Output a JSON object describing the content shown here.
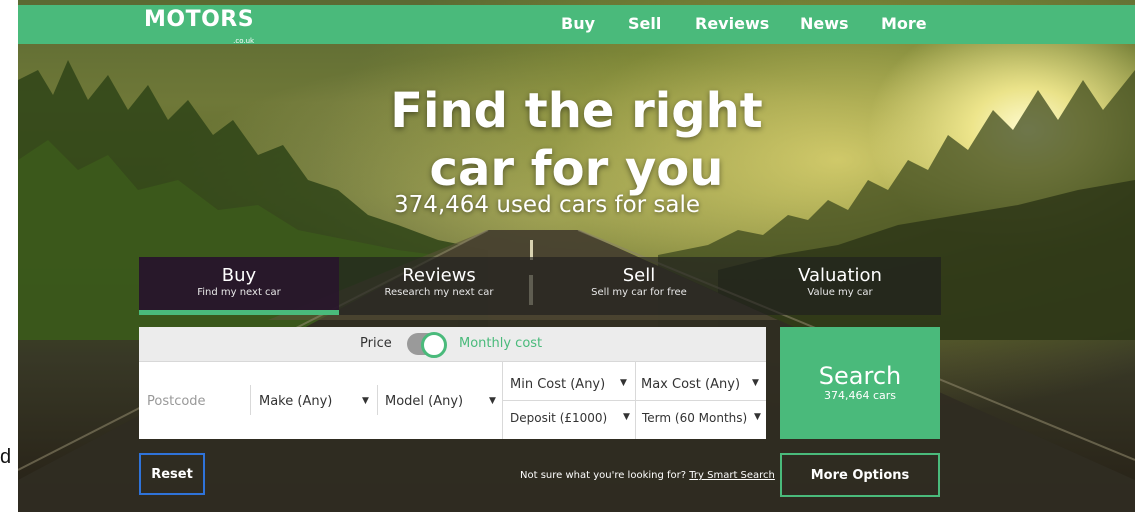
{
  "stray_text": "d",
  "brand": {
    "name": "MOTORS",
    "sub": ".co.uk"
  },
  "nav": {
    "items": [
      {
        "label": "Buy"
      },
      {
        "label": "Sell"
      },
      {
        "label": "Reviews"
      },
      {
        "label": "News"
      },
      {
        "label": "More"
      }
    ]
  },
  "hero": {
    "headline_line1": "Find the right",
    "headline_line2": "car for you",
    "subhead": "374,464 used cars for sale"
  },
  "tabs": [
    {
      "title": "Buy",
      "subtitle": "Find my next car",
      "active": true
    },
    {
      "title": "Reviews",
      "subtitle": "Research my next car",
      "active": false
    },
    {
      "title": "Sell",
      "subtitle": "Sell my car for free",
      "active": false
    },
    {
      "title": "Valuation",
      "subtitle": "Value my car",
      "active": false
    }
  ],
  "search": {
    "price_label": "Price",
    "monthly_label": "Monthly cost",
    "monthly_enabled": true,
    "postcode_placeholder": "Postcode",
    "make": "Make (Any)",
    "model": "Model (Any)",
    "min_cost": "Min Cost (Any)",
    "max_cost": "Max Cost (Any)",
    "deposit": "Deposit (£1000)",
    "term": "Term (60 Months)",
    "button_label": "Search",
    "button_count": "374,464 cars"
  },
  "footer": {
    "reset_label": "Reset",
    "smart_prompt": "Not sure what you're looking for?",
    "smart_link": "Try Smart Search",
    "more_label": "More Options"
  },
  "colors": {
    "brand_green": "#4aba7b",
    "reset_border": "#2f73d9"
  },
  "icons": [
    "dropdown-arrow-icon"
  ]
}
